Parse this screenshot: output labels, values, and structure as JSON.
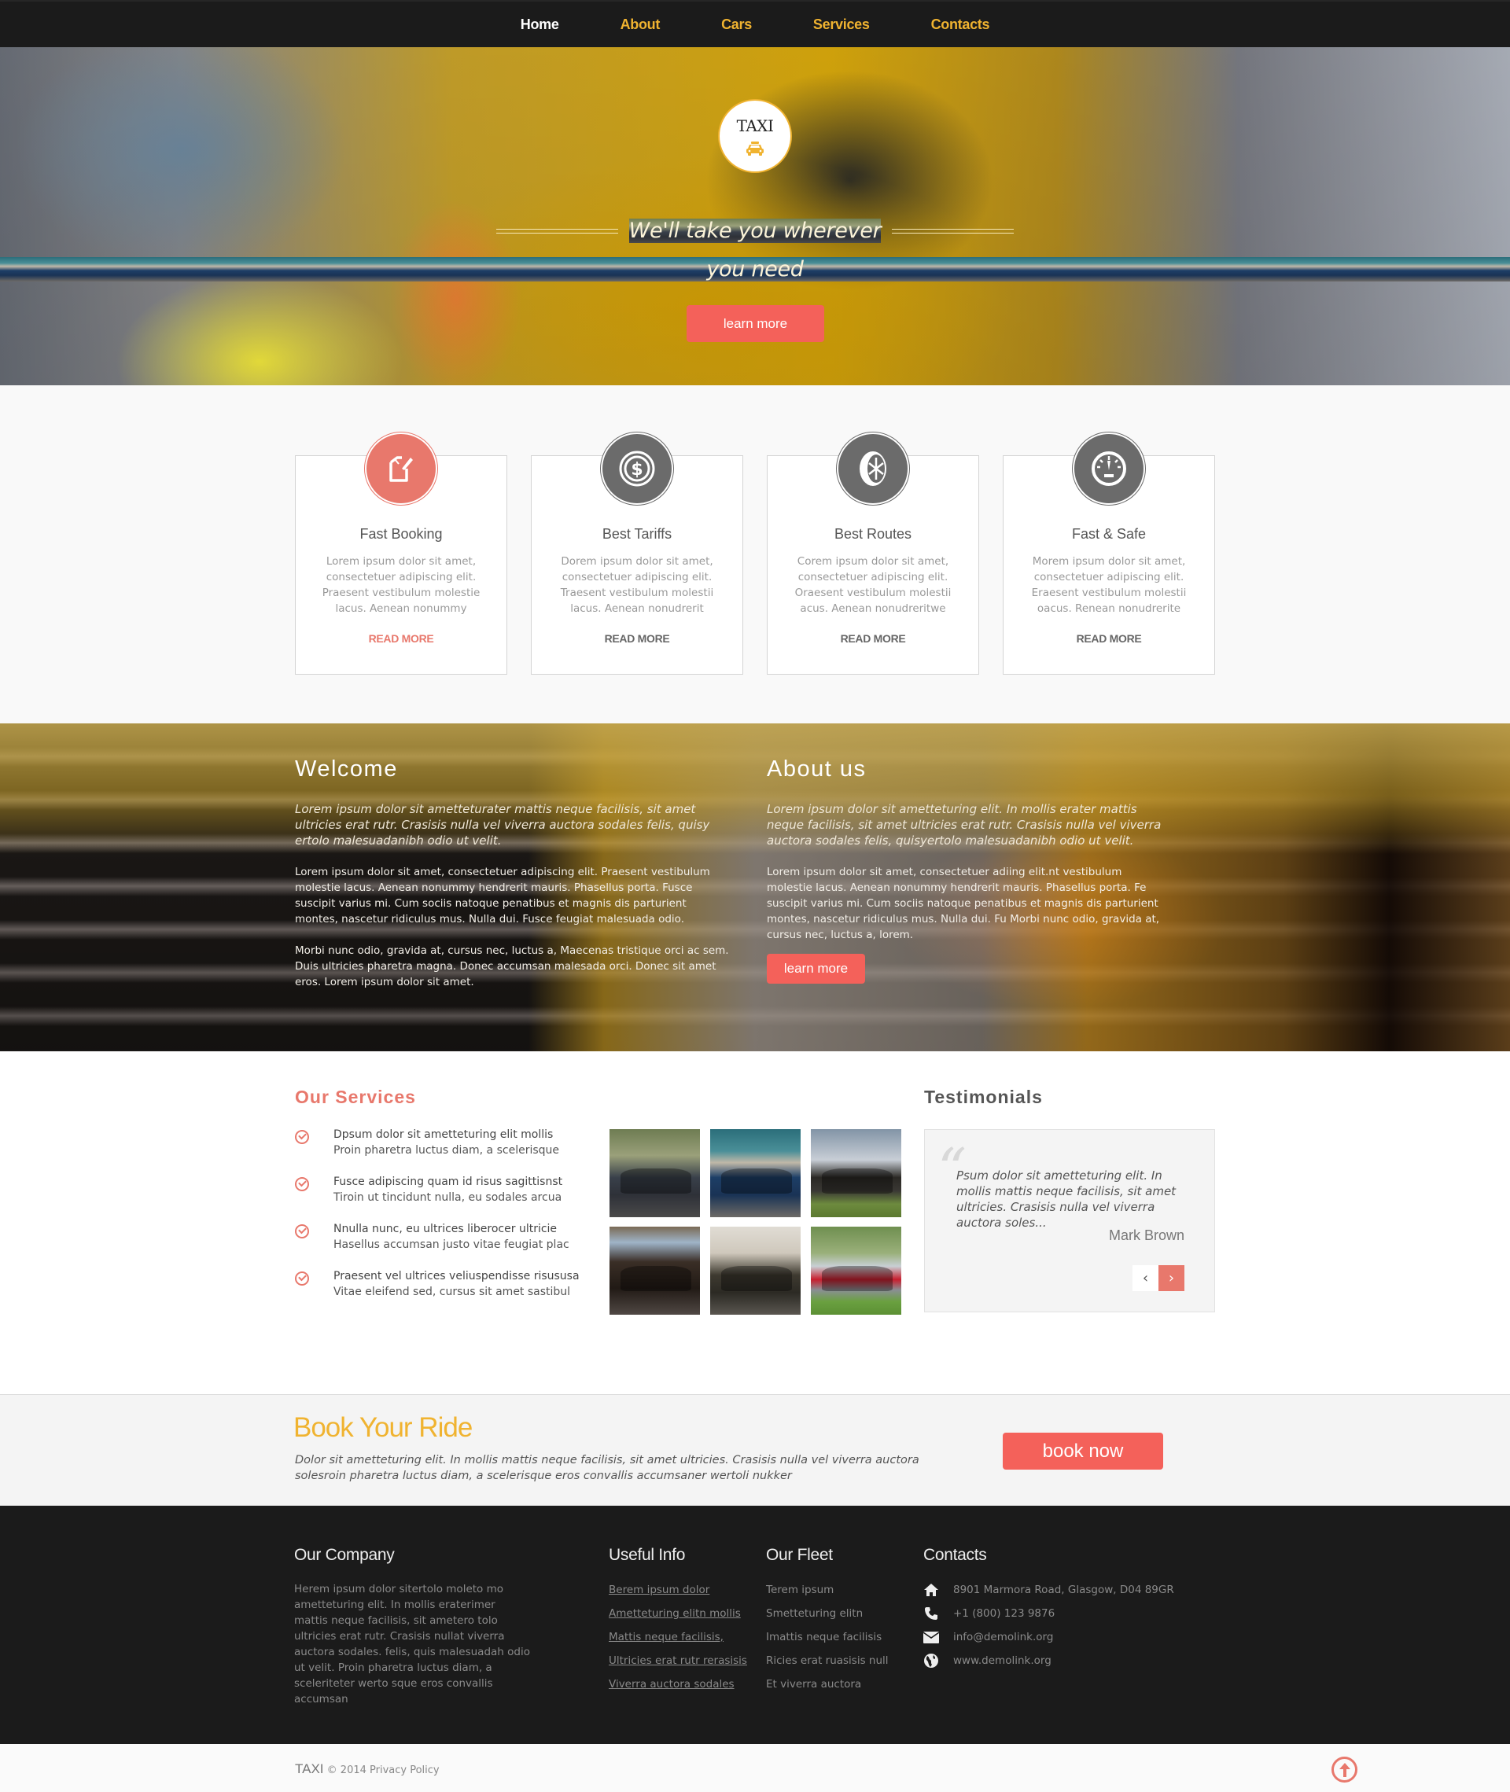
{
  "nav": {
    "items": [
      {
        "label": "Home",
        "active": true
      },
      {
        "label": "About",
        "active": false
      },
      {
        "label": "Cars",
        "active": false
      },
      {
        "label": "Services",
        "active": false
      },
      {
        "label": "Contacts",
        "active": false
      }
    ]
  },
  "hero": {
    "logo_text": "TAXI",
    "logo_icon": "taxi-car-icon",
    "tagline_line1": "We'll take you wherever",
    "tagline_line2": "you need",
    "button_label": "learn more"
  },
  "features": [
    {
      "title": "Fast Booking",
      "icon": "edit-document-icon",
      "text": "Lorem ipsum dolor sit amet, consectetuer adipiscing elit. Praesent vestibulum molestie lacus. Aenean nonummy",
      "link": "READ MORE",
      "highlight": true
    },
    {
      "title": "Best Tariffs",
      "icon": "dollar-coin-icon",
      "text": "Dorem ipsum dolor sit amet, consectetuer adipiscing elit. Traesent vestibulum molestii lacus. Aenean nonudrerit",
      "link": "READ MORE",
      "highlight": false
    },
    {
      "title": "Best Routes",
      "icon": "wheel-icon",
      "text": "Corem ipsum dolor sit amet, consectetuer adipiscing elit. Oraesent vestibulum molestii acus. Aenean nonudreritwe",
      "link": "READ MORE",
      "highlight": false
    },
    {
      "title": "Fast & Safe",
      "icon": "speedometer-icon",
      "text": "Morem ipsum dolor sit amet, consectetuer adipiscing elit. Eraesent vestibulum molestii oacus. Renean nonudrerite",
      "link": "READ MORE",
      "highlight": false
    }
  ],
  "welcome": {
    "title": "Welcome",
    "lead": "Lorem ipsum dolor sit ametteturater mattis neque facilisis, sit amet ultricies erat rutr. Crasisis nulla vel viverra auctora sodales felis, quisy ertolo malesuadanibh odio ut velit.",
    "body1": "Lorem ipsum dolor sit amet, consectetuer adipiscing elit. Praesent vestibulum molestie lacus. Aenean nonummy hendrerit mauris. Phasellus porta. Fusce suscipit varius mi. Cum sociis natoque penatibus et magnis dis parturient montes, nascetur ridiculus mus. Nulla dui. Fusce feugiat malesuada odio.",
    "body2": "Morbi nunc odio, gravida at, cursus nec, luctus a,  Maecenas tristique orci ac sem. Duis ultricies pharetra magna. Donec accumsan malesada orci. Donec sit amet eros. Lorem ipsum dolor sit amet."
  },
  "about": {
    "title": "About us",
    "lead": "Lorem ipsum dolor sit ametteturing elit. In mollis erater mattis neque facilisis, sit amet ultricies erat rutr. Crasisis nulla vel viverra auctora sodales felis, quisyertolo malesuadanibh odio ut velit.",
    "body": "Lorem ipsum dolor sit amet, consectetuer adiing elit.nt vestibulum molestie lacus. Aenean nonummy hendrerit mauris. Phasellus porta. Fe suscipit varius mi. Cum sociis natoque penatibus et magnis dis parturient montes, nascetur ridiculus mus. Nulla dui. Fu Morbi nunc odio, gravida at, cursus nec, luctus a, lorem.",
    "button_label": "learn more"
  },
  "services": {
    "title": "Our Services",
    "items": [
      {
        "line1": "Dpsum dolor sit ametteturing elit mollis",
        "line2": "Proin pharetra luctus diam, a scelerisque"
      },
      {
        "line1": "Fusce adipiscing quam id risus sagittisnst",
        "line2": "Tiroin ut tincidunt nulla, eu sodales arcua"
      },
      {
        "line1": "Nnulla nunc, eu ultrices liberocer ultricie",
        "line2": "Hasellus accumsan justo vitae feugiat plac"
      },
      {
        "line1": "Praesent vel ultrices veliuspendisse risususa",
        "line2": " Vitae eleifend sed, cursus sit amet sastibul"
      }
    ],
    "gallery": [
      {
        "name": "dark-sedan-photo"
      },
      {
        "name": "blue-hatchback-photo"
      },
      {
        "name": "pickup-truck-photo"
      },
      {
        "name": "black-luxury-sedan-photo"
      },
      {
        "name": "suv-photo"
      },
      {
        "name": "red-hatchback-photo"
      }
    ]
  },
  "testimonials": {
    "title": "Testimonials",
    "quote": "Psum dolor sit ametteturing elit. In mollis mattis neque facilisis, sit amet ultricies. Crasisis nulla vel viverra auctora soles...",
    "author": "Mark Brown",
    "prev_label": "‹",
    "next_label": "›"
  },
  "book": {
    "title": "Book Your Ride",
    "text": "Dolor sit ametteturing elit. In mollis  mattis neque facilisis, sit amet ultricies. Crasisis nulla vel viverra auctora solesroin pharetra luctus diam, a scelerisque eros convallis accumsaner wertoli nukker",
    "button_label": "book now"
  },
  "footer": {
    "company": {
      "title": "Our Company",
      "text": "Herem ipsum dolor sitertolo moleto mo ametteturing elit. In mollis eraterimer mattis neque facilisis, sit ametero tolo ultricies erat rutr. Crasisis nullat viverra auctora sodales. felis, quis malesuadah odio ut velit. Proin pharetra luctus diam, a sceleriteter werto sque eros convallis accumsan"
    },
    "useful": {
      "title": "Useful Info",
      "links": [
        "Berem ipsum dolor ",
        "Ametteturing elitn mollis ",
        "Mattis neque facilisis, ",
        "Ultricies erat rutr rerasisis",
        "Viverra auctora sodales"
      ]
    },
    "fleet": {
      "title": "Our Fleet",
      "items": [
        "Terem ipsum",
        "Smetteturing elitn",
        "Imattis neque facilisis",
        "Ricies erat ruasisis null",
        "Et viverra auctora"
      ]
    },
    "contacts": {
      "title": "Contacts",
      "address": "8901 Marmora Road, Glasgow,  D04 89GR",
      "phone": "+1 (800) 123 9876",
      "email": "info@demolink.org",
      "website": "www.demolink.org"
    }
  },
  "bottom": {
    "brand": "TAXI",
    "copyright": "© 2014",
    "privacy": "Privacy Policy"
  },
  "colors": {
    "accent": "#f4615a",
    "accent_soft": "#e8786c",
    "brand_yellow": "#f0b330",
    "nav_bg": "#1b1b1b",
    "footer_bg": "#1b1b1b"
  }
}
